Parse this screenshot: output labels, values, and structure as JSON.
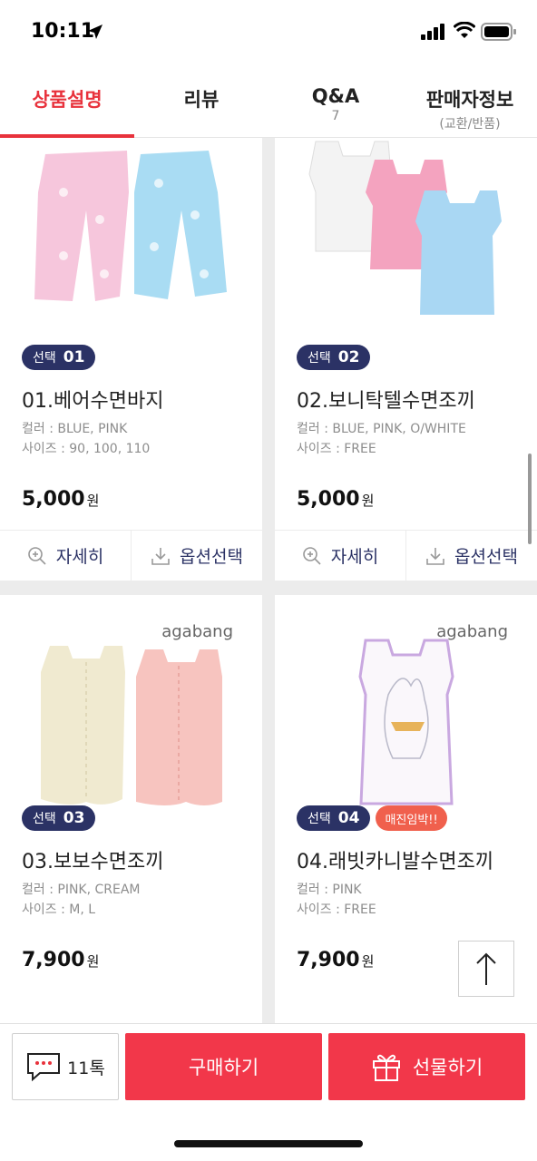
{
  "status": {
    "time": "10:11"
  },
  "tabs": [
    {
      "label": "상품설명",
      "sub": ""
    },
    {
      "label": "리뷰",
      "sub": ""
    },
    {
      "label": "Q&A",
      "sub": "7"
    },
    {
      "label": "판매자정보",
      "sub": "(교환/반품)"
    }
  ],
  "products": [
    {
      "badge_prefix": "선택",
      "badge_num": "01",
      "soon": "",
      "name": "01.베어수면바지",
      "color_line": "컬러 : BLUE, PINK",
      "size_line": "사이즈 : 90, 100, 110",
      "price": "5,000",
      "won": "원"
    },
    {
      "badge_prefix": "선택",
      "badge_num": "02",
      "soon": "",
      "name": "02.보니탁텔수면조끼",
      "color_line": "컬러 : BLUE, PINK, O/WHITE",
      "size_line": "사이즈 : FREE",
      "price": "5,000",
      "won": "원"
    },
    {
      "badge_prefix": "선택",
      "badge_num": "03",
      "soon": "",
      "name": "03.보보수면조끼",
      "color_line": "컬러 : PINK, CREAM",
      "size_line": "사이즈 : M, L",
      "price": "7,900",
      "won": "원",
      "brand": "agabang"
    },
    {
      "badge_prefix": "선택",
      "badge_num": "04",
      "soon": "매진임박!!",
      "name": "04.래빗카니발수면조끼",
      "color_line": "컬러 : PINK",
      "size_line": "사이즈 : FREE",
      "price": "7,900",
      "won": "원",
      "brand": "agabang"
    }
  ],
  "actions": {
    "detail": "자세히",
    "option": "옵션선택"
  },
  "bottom": {
    "talk": "11톡",
    "buy": "구매하기",
    "gift": "선물하기"
  },
  "colors": {
    "accent": "#e8323c",
    "navy": "#2b3265",
    "buy": "#f2374a",
    "soon": "#f0604d"
  }
}
